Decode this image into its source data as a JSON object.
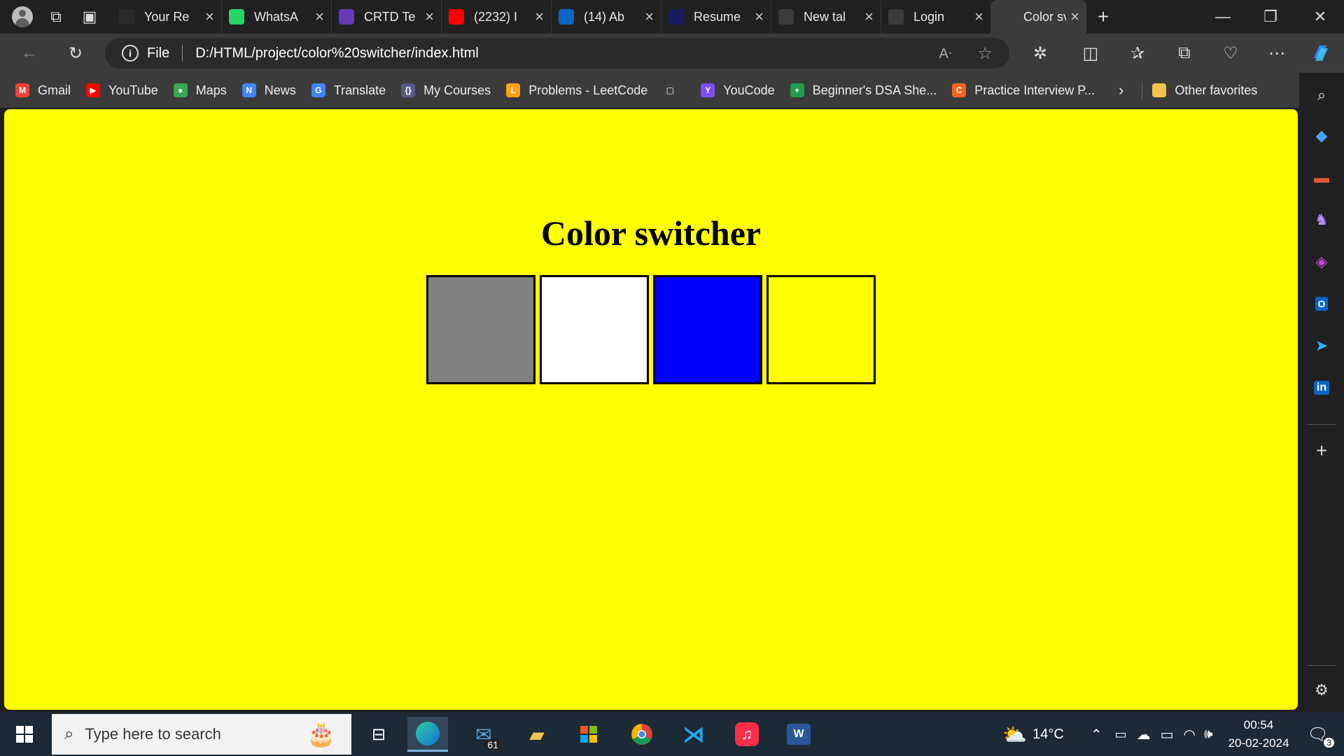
{
  "tabs": [
    {
      "title": "Your Re",
      "icon": "github-icon",
      "color": "#2a2a2a"
    },
    {
      "title": "WhatsA",
      "icon": "whatsapp-icon",
      "color": "#25d366"
    },
    {
      "title": "CRTD Te",
      "icon": "forms-icon",
      "color": "#673ab7"
    },
    {
      "title": "(2232) I",
      "icon": "youtube-icon",
      "color": "#ff0000"
    },
    {
      "title": "(14) Ab",
      "icon": "linkedin-icon",
      "color": "#0a66c2"
    },
    {
      "title": "Resume",
      "icon": "resume-r-icon",
      "color": "#1a1a5e"
    },
    {
      "title": "New tal",
      "icon": "newtab-icon",
      "color": "#3b3b3b"
    },
    {
      "title": "Login",
      "icon": "page-icon",
      "color": "#3b3b3b"
    },
    {
      "title": "Color sv",
      "icon": "page-icon",
      "color": "#3b3b3b"
    }
  ],
  "address": {
    "scheme": "File",
    "url": "D:/HTML/project/color%20switcher/index.html"
  },
  "bookmarks": [
    {
      "label": "Gmail",
      "icon": "gmail-icon",
      "color": "#ea4335",
      "glyph": "M"
    },
    {
      "label": "YouTube",
      "icon": "youtube-icon",
      "color": "#ff0000",
      "glyph": "▶"
    },
    {
      "label": "Maps",
      "icon": "maps-icon",
      "color": "#34a853",
      "glyph": "●"
    },
    {
      "label": "News",
      "icon": "news-icon",
      "color": "#4285f4",
      "glyph": "N"
    },
    {
      "label": "Translate",
      "icon": "translate-icon",
      "color": "#4285f4",
      "glyph": "G"
    },
    {
      "label": "My Courses",
      "icon": "courses-icon",
      "color": "#5a5a8a",
      "glyph": "{}"
    },
    {
      "label": "Problems - LeetCode",
      "icon": "leetcode-icon",
      "color": "#ffa116",
      "glyph": "L"
    },
    {
      "label": "",
      "icon": "page-icon",
      "color": "#3b3b3b",
      "glyph": "▢"
    },
    {
      "label": "YouCode",
      "icon": "youcode-icon",
      "color": "#7b4dff",
      "glyph": "Y"
    },
    {
      "label": "Beginner's DSA She...",
      "icon": "dsa-sheet-icon",
      "color": "#1e9e4a",
      "glyph": "+"
    },
    {
      "label": "Practice Interview P...",
      "icon": "interview-icon",
      "color": "#f26522",
      "glyph": "C"
    }
  ],
  "bookmarks_other": "Other favorites",
  "page": {
    "title": "Color switcher",
    "background": "#ffff00",
    "swatches": [
      {
        "color": "#808080"
      },
      {
        "color": "#ffffff"
      },
      {
        "color": "#0000ff"
      },
      {
        "color": "#ffff00"
      }
    ]
  },
  "taskbar": {
    "search_placeholder": "Type here to search",
    "mail_badge": "61",
    "weather": "14°C",
    "time": "00:54",
    "date": "20-02-2024",
    "notifications": "3"
  }
}
